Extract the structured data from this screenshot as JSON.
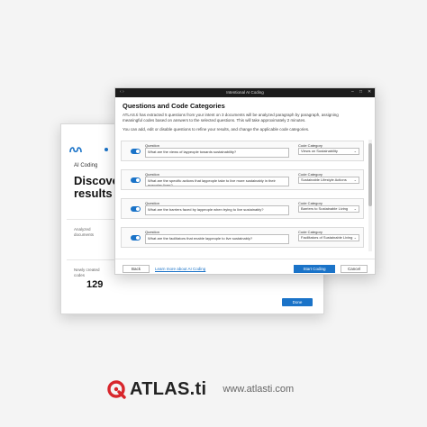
{
  "back_window": {
    "subtitle": "AI Coding",
    "heading": "Discover results",
    "analyzed_label": "Analyzed documents",
    "codes_label": "Newly created codes",
    "codes_count": "129",
    "done_label": "Done"
  },
  "dialog": {
    "window_title": "Intentional AI Coding",
    "title": "Questions and Code Categories",
    "description": "ATLAS.ti has extracted 5 questions from your intent on 3 documents will be analyzed paragraph by paragraph, assigning meaningful codes based on answers to the selected questions. This will take approximately 2 minutes.",
    "instructions": "You can add, edit or disable questions to refine your results, and change the applicable code categories.",
    "question_label": "Question",
    "category_label": "Code Category",
    "rows": [
      {
        "question": "What are the views of laypeople towards sustainability?",
        "category": "Views on Sustainability"
      },
      {
        "question": "What are the specific actions that laypeople take to live more sustainably in their everyday lives?",
        "category": "Sustainable Lifestyle Actions"
      },
      {
        "question": "What are the barriers faced by laypeople when trying to live sustainably?",
        "category": "Barriers to Sustainable Living"
      },
      {
        "question": "What are the facilitators that enable laypeople to live sustainably?",
        "category": "Facilitators of Sustainable Living"
      }
    ],
    "back_label": "Back",
    "learn_more": "Learn more about AI Coding",
    "start_label": "Start Coding",
    "cancel_label": "Cancel"
  },
  "brand": {
    "name": "ATLAS.ti",
    "url": "www.atlasti.com",
    "accent": "#d8262c"
  },
  "colors": {
    "primary": "#1a73c8",
    "titlebar": "#1c1c1c"
  }
}
